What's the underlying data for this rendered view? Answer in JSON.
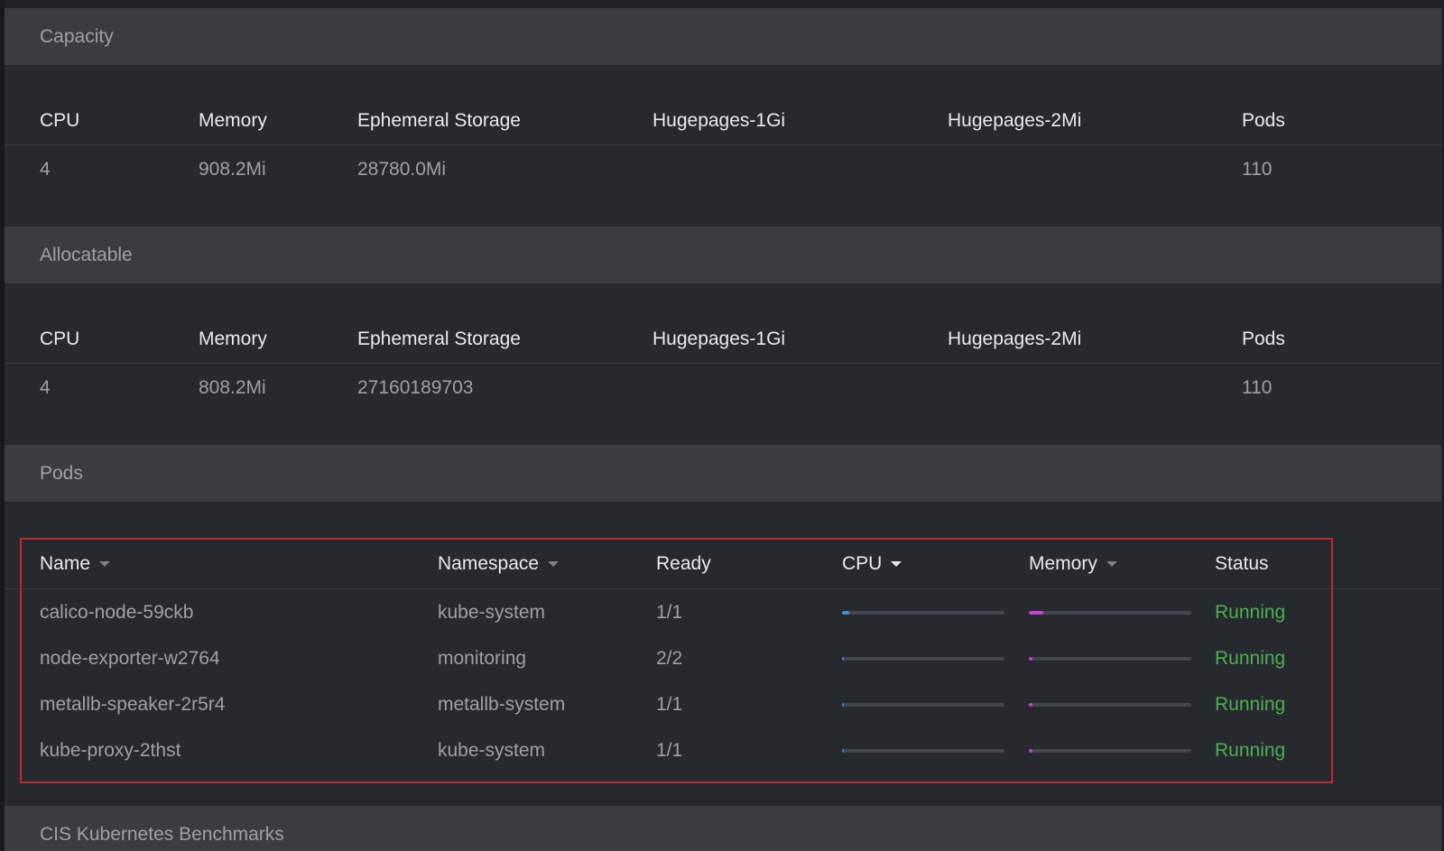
{
  "capacity": {
    "title": "Capacity",
    "headers": [
      "CPU",
      "Memory",
      "Ephemeral Storage",
      "Hugepages-1Gi",
      "Hugepages-2Mi",
      "Pods"
    ],
    "values": [
      "4",
      "908.2Mi",
      "28780.0Mi",
      "",
      "",
      "110"
    ]
  },
  "allocatable": {
    "title": "Allocatable",
    "headers": [
      "CPU",
      "Memory",
      "Ephemeral Storage",
      "Hugepages-1Gi",
      "Hugepages-2Mi",
      "Pods"
    ],
    "values": [
      "4",
      "808.2Mi",
      "27160189703",
      "",
      "",
      "110"
    ]
  },
  "pods": {
    "title": "Pods",
    "columns": {
      "name": "Name",
      "namespace": "Namespace",
      "ready": "Ready",
      "cpu": "CPU",
      "memory": "Memory",
      "status": "Status"
    },
    "rows": [
      {
        "name": "calico-node-59ckb",
        "namespace": "kube-system",
        "ready": "1/1",
        "cpu_usage": 0.045,
        "memory_usage": 0.09,
        "status": "Running"
      },
      {
        "name": "node-exporter-w2764",
        "namespace": "monitoring",
        "ready": "2/2",
        "cpu_usage": 0.01,
        "memory_usage": 0.02,
        "status": "Running"
      },
      {
        "name": "metallb-speaker-2r5r4",
        "namespace": "metallb-system",
        "ready": "1/1",
        "cpu_usage": 0.01,
        "memory_usage": 0.02,
        "status": "Running"
      },
      {
        "name": "kube-proxy-2thst",
        "namespace": "kube-system",
        "ready": "1/1",
        "cpu_usage": 0.01,
        "memory_usage": 0.02,
        "status": "Running"
      }
    ]
  },
  "next_section": {
    "title": "CIS Kubernetes Benchmarks"
  },
  "colors": {
    "cpu_bar": "#3d8fe0",
    "memory_bar": "#c63fd6",
    "status_running": "#4caf50",
    "highlight": "#c0262d"
  },
  "icons": {
    "sort": "caret-down-icon"
  }
}
